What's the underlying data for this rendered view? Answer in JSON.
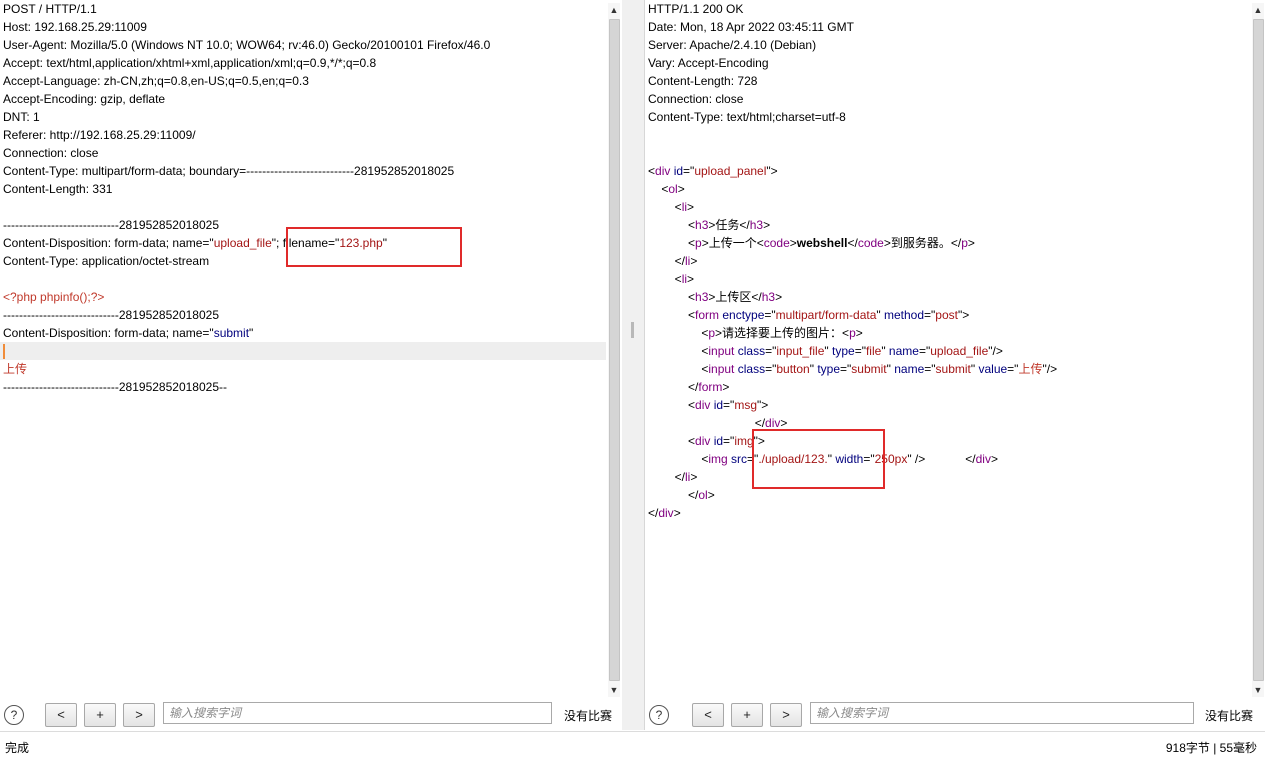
{
  "request": {
    "lines": [
      [
        {
          "t": "POST / HTTP/1.1"
        }
      ],
      [
        {
          "t": "Host: 192.168.25.29:11009"
        }
      ],
      [
        {
          "t": "User-Agent: Mozilla/5.0 (Windows NT 10.0; WOW64; rv:46.0) Gecko/20100101 Firefox/46.0"
        }
      ],
      [
        {
          "t": "Accept: text/html,application/xhtml+xml,application/xml;q=0.9,*/*;q=0.8"
        }
      ],
      [
        {
          "t": "Accept-Language: zh-CN,zh;q=0.8,en-US;q=0.5,en;q=0.3"
        }
      ],
      [
        {
          "t": "Accept-Encoding: gzip, deflate"
        }
      ],
      [
        {
          "t": "DNT: 1"
        }
      ],
      [
        {
          "t": "Referer: http://192.168.25.29:11009/"
        }
      ],
      [
        {
          "t": "Connection: close"
        }
      ],
      [
        {
          "t": "Content-Type: multipart/form-data; boundary=---------------------------281952852018025"
        }
      ],
      [
        {
          "t": "Content-Length: 331"
        }
      ],
      [
        {
          "t": ""
        }
      ],
      [
        {
          "t": "-----------------------------281952852018025"
        }
      ],
      [
        {
          "t": "Content-Disposition: form-data; name=\""
        },
        {
          "t": "upload_file",
          "c": "str"
        },
        {
          "t": "\"; filename=\""
        },
        {
          "t": "123.php",
          "c": "str"
        },
        {
          "t": "\""
        }
      ],
      [
        {
          "t": "Content-Type: application/octet-stream"
        }
      ],
      [
        {
          "t": ""
        }
      ],
      [
        {
          "t": "<?php phpinfo();?>",
          "c": "red"
        }
      ],
      [
        {
          "t": "-----------------------------281952852018025"
        }
      ],
      [
        {
          "t": "Content-Disposition: form-data; name=\""
        },
        {
          "t": "submit",
          "c": "attr"
        },
        {
          "t": "\""
        }
      ],
      [
        {
          "caret": true
        }
      ],
      [
        {
          "t": "上传",
          "c": "red"
        }
      ],
      [
        {
          "t": "-----------------------------281952852018025--"
        }
      ]
    ],
    "current_line": 19,
    "search": {
      "placeholder": "输入搜索字词",
      "value": "",
      "prev": "<",
      "add": "+",
      "next": ">",
      "matches": "没有比赛",
      "help": "?"
    }
  },
  "response": {
    "lines": [
      [
        {
          "t": "HTTP/1.1 200 OK"
        }
      ],
      [
        {
          "t": "Date: Mon, 18 Apr 2022 03:45:11 GMT"
        }
      ],
      [
        {
          "t": "Server: Apache/2.4.10 (Debian)"
        }
      ],
      [
        {
          "t": "Vary: Accept-Encoding"
        }
      ],
      [
        {
          "t": "Content-Length: 728"
        }
      ],
      [
        {
          "t": "Connection: close"
        }
      ],
      [
        {
          "t": "Content-Type: text/html;charset=utf-8"
        }
      ],
      [
        {
          "t": ""
        }
      ],
      [
        {
          "t": ""
        }
      ],
      [
        {
          "t": "<"
        },
        {
          "t": "div",
          "c": "tag"
        },
        {
          "t": " "
        },
        {
          "t": "id",
          "c": "attr"
        },
        {
          "t": "=\""
        },
        {
          "t": "upload_panel",
          "c": "str"
        },
        {
          "t": "\">"
        }
      ],
      [
        {
          "t": "    <"
        },
        {
          "t": "ol",
          "c": "tag"
        },
        {
          "t": ">"
        }
      ],
      [
        {
          "t": "        <"
        },
        {
          "t": "li",
          "c": "tag"
        },
        {
          "t": ">"
        }
      ],
      [
        {
          "t": "            <"
        },
        {
          "t": "h3",
          "c": "tag"
        },
        {
          "t": ">任务</"
        },
        {
          "t": "h3",
          "c": "tag"
        },
        {
          "t": ">"
        }
      ],
      [
        {
          "t": "            <"
        },
        {
          "t": "p",
          "c": "tag"
        },
        {
          "t": ">上传一个<"
        },
        {
          "t": "code",
          "c": "tag"
        },
        {
          "t": ">"
        },
        {
          "t": "webshell",
          "c": "b"
        },
        {
          "t": "</"
        },
        {
          "t": "code",
          "c": "tag"
        },
        {
          "t": ">到服务器。</"
        },
        {
          "t": "p",
          "c": "tag"
        },
        {
          "t": ">"
        }
      ],
      [
        {
          "t": "        </"
        },
        {
          "t": "li",
          "c": "tag"
        },
        {
          "t": ">"
        }
      ],
      [
        {
          "t": "        <"
        },
        {
          "t": "li",
          "c": "tag"
        },
        {
          "t": ">"
        }
      ],
      [
        {
          "t": "            <"
        },
        {
          "t": "h3",
          "c": "tag"
        },
        {
          "t": ">上传区</"
        },
        {
          "t": "h3",
          "c": "tag"
        },
        {
          "t": ">"
        }
      ],
      [
        {
          "t": "            <"
        },
        {
          "t": "form",
          "c": "tag"
        },
        {
          "t": " "
        },
        {
          "t": "enctype",
          "c": "attr"
        },
        {
          "t": "=\""
        },
        {
          "t": "multipart/form-data",
          "c": "str"
        },
        {
          "t": "\" "
        },
        {
          "t": "method",
          "c": "attr"
        },
        {
          "t": "=\""
        },
        {
          "t": "post",
          "c": "str"
        },
        {
          "t": "\">"
        }
      ],
      [
        {
          "t": "                <"
        },
        {
          "t": "p",
          "c": "tag"
        },
        {
          "t": ">请选择要上传的图片：<"
        },
        {
          "t": "p",
          "c": "tag"
        },
        {
          "t": ">"
        }
      ],
      [
        {
          "t": "                <"
        },
        {
          "t": "input",
          "c": "tag"
        },
        {
          "t": " "
        },
        {
          "t": "class",
          "c": "attr"
        },
        {
          "t": "=\""
        },
        {
          "t": "input_file",
          "c": "str"
        },
        {
          "t": "\" "
        },
        {
          "t": "type",
          "c": "attr"
        },
        {
          "t": "=\""
        },
        {
          "t": "file",
          "c": "str"
        },
        {
          "t": "\" "
        },
        {
          "t": "name",
          "c": "attr"
        },
        {
          "t": "=\""
        },
        {
          "t": "upload_file",
          "c": "str"
        },
        {
          "t": "\"/>"
        }
      ],
      [
        {
          "t": "                <"
        },
        {
          "t": "input",
          "c": "tag"
        },
        {
          "t": " "
        },
        {
          "t": "class",
          "c": "attr"
        },
        {
          "t": "=\""
        },
        {
          "t": "button",
          "c": "str"
        },
        {
          "t": "\" "
        },
        {
          "t": "type",
          "c": "attr"
        },
        {
          "t": "=\""
        },
        {
          "t": "submit",
          "c": "str"
        },
        {
          "t": "\" "
        },
        {
          "t": "name",
          "c": "attr"
        },
        {
          "t": "=\""
        },
        {
          "t": "submit",
          "c": "str"
        },
        {
          "t": "\" "
        },
        {
          "t": "value",
          "c": "attr"
        },
        {
          "t": "=\""
        },
        {
          "t": "上传",
          "c": "red"
        },
        {
          "t": "\"/>"
        }
      ],
      [
        {
          "t": "            </"
        },
        {
          "t": "form",
          "c": "tag"
        },
        {
          "t": ">"
        }
      ],
      [
        {
          "t": "            <"
        },
        {
          "t": "div",
          "c": "tag"
        },
        {
          "t": " "
        },
        {
          "t": "id",
          "c": "attr"
        },
        {
          "t": "=\""
        },
        {
          "t": "msg",
          "c": "str"
        },
        {
          "t": "\">"
        }
      ],
      [
        {
          "t": "                                </"
        },
        {
          "t": "div",
          "c": "tag"
        },
        {
          "t": ">"
        }
      ],
      [
        {
          "t": "            <"
        },
        {
          "t": "div",
          "c": "tag"
        },
        {
          "t": " "
        },
        {
          "t": "id",
          "c": "attr"
        },
        {
          "t": "=\""
        },
        {
          "t": "img",
          "c": "str"
        },
        {
          "t": "\">"
        }
      ],
      [
        {
          "t": "                <"
        },
        {
          "t": "img",
          "c": "tag"
        },
        {
          "t": " "
        },
        {
          "t": "src",
          "c": "attr"
        },
        {
          "t": "=\""
        },
        {
          "t": "./upload/123.",
          "c": "str"
        },
        {
          "t": "\" "
        },
        {
          "t": "width",
          "c": "attr"
        },
        {
          "t": "=\""
        },
        {
          "t": "250px",
          "c": "str"
        },
        {
          "t": "\" />            </"
        },
        {
          "t": "div",
          "c": "tag"
        },
        {
          "t": ">"
        }
      ],
      [
        {
          "t": "        </"
        },
        {
          "t": "li",
          "c": "tag"
        },
        {
          "t": ">"
        }
      ],
      [
        {
          "t": "            </"
        },
        {
          "t": "ol",
          "c": "tag"
        },
        {
          "t": ">"
        }
      ],
      [
        {
          "t": "</"
        },
        {
          "t": "div",
          "c": "tag"
        },
        {
          "t": ">"
        }
      ]
    ],
    "search": {
      "placeholder": "输入搜索字词",
      "value": "",
      "prev": "<",
      "add": "+",
      "next": ">",
      "matches": "没有比赛",
      "help": "?"
    }
  },
  "status": {
    "left": "完成",
    "right": "918字节 | 55毫秒"
  },
  "colors": {
    "highlight_box": "#e02a2a",
    "tag": "#800080",
    "attr": "#00007d",
    "string": "#a31515",
    "caret": "#f08c3a"
  }
}
